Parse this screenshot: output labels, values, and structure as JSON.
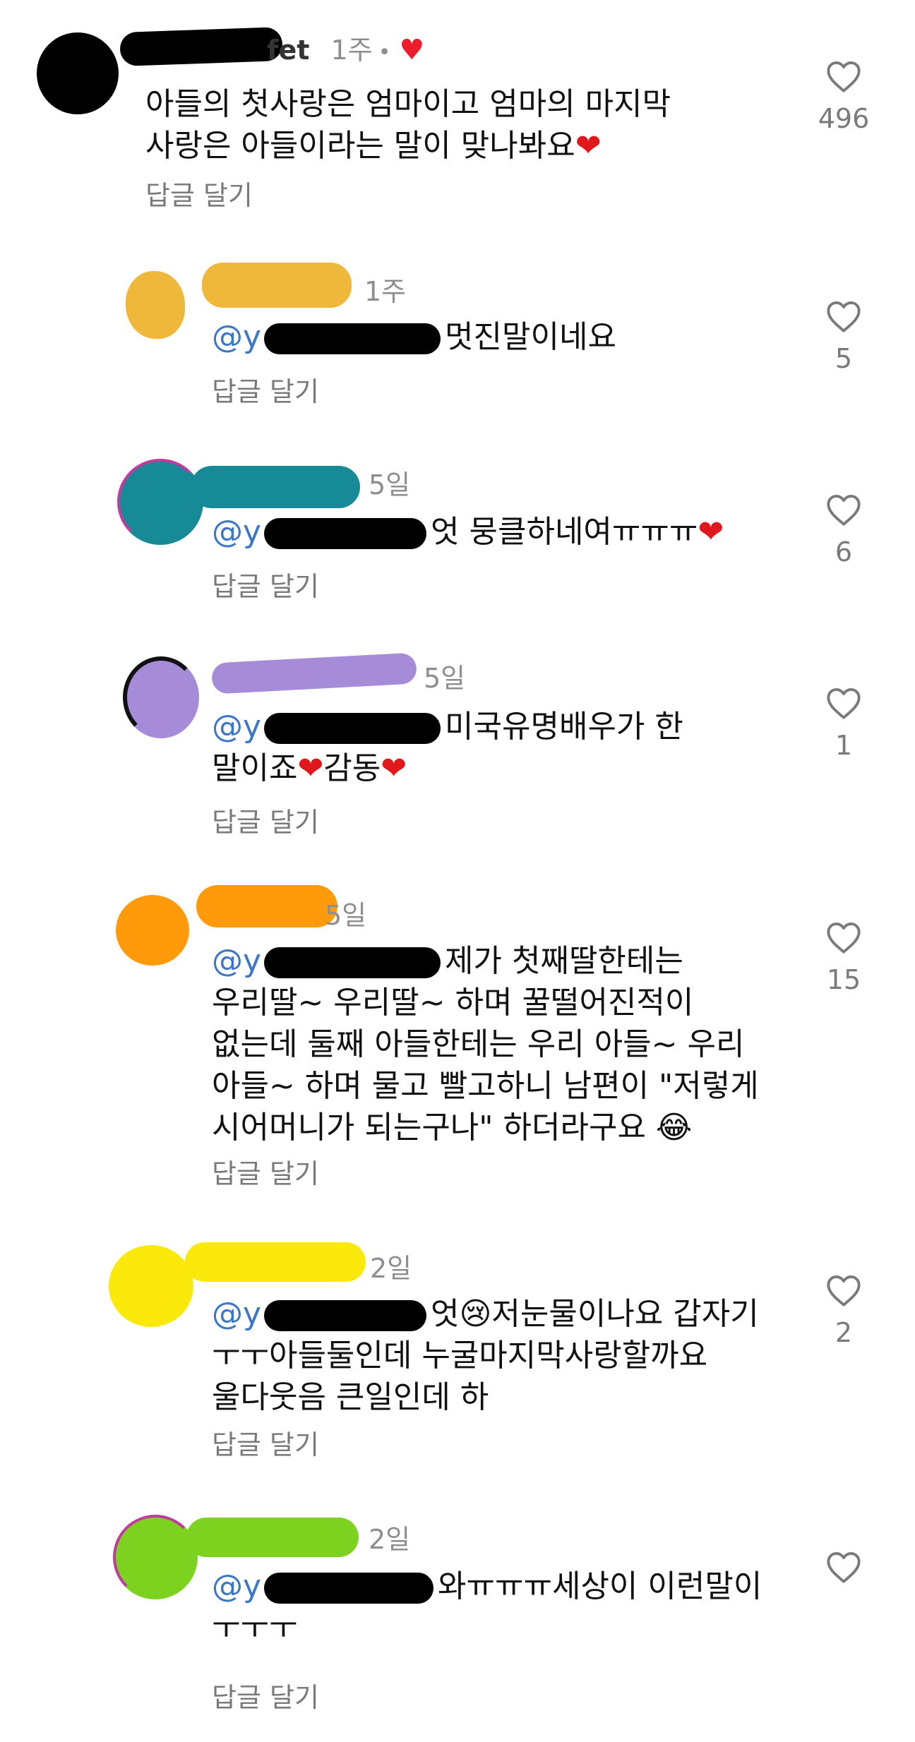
{
  "colors": {
    "mention": "#3b76c9",
    "meta": "#8e8e8e",
    "heart": "#e0181b"
  },
  "comments": [
    {
      "username_visible": "fet",
      "time": "1주",
      "author_liked": true,
      "text_lines": [
        "아들의 첫사랑은 엄마이고 엄마의 마지막",
        "사랑은 아들이라는 말이 맞나봐요"
      ],
      "reply_label": "답글 달기",
      "likes": "496",
      "avatar_color": "#000000"
    },
    {
      "time": "1주",
      "mention_prefix": "@y",
      "text_lines": [
        "멋진말이네요"
      ],
      "reply_label": "답글 달기",
      "likes": "5",
      "avatar_color": "#f0b83a"
    },
    {
      "time": "5일",
      "mention_prefix": "@y",
      "text_lines": [
        "엇 뭉클하네여ㅠㅠㅠ"
      ],
      "reply_label": "답글 달기",
      "likes": "6",
      "avatar_color": "#168a96"
    },
    {
      "time": "5일",
      "mention_prefix": "@y",
      "text_lines": [
        "미국유명배우가 한",
        "말이죠",
        "감동"
      ],
      "reply_label": "답글 달기",
      "likes": "1",
      "avatar_color": "#a68bd8"
    },
    {
      "time": "5일",
      "mention_prefix": "@y",
      "text_lines": [
        "제가 첫째딸한테는",
        "우리딸~ 우리딸~ 하며 꿀떨어진적이",
        "없는데 둘째 아들한테는 우리 아들~ 우리",
        "아들~ 하며 물고 빨고하니 남편이 \"저렇게",
        "시어머니가 되는구나\" 하더라구요 😂"
      ],
      "reply_label": "답글 달기",
      "likes": "15",
      "avatar_color": "#ff9a0a"
    },
    {
      "time": "2일",
      "mention_prefix": "@y",
      "text_lines": [
        "엇😢저눈물이나요 갑자기",
        "ㅜㅜ아들둘인데 누굴마지막사랑할까요",
        "울다웃음 큰일인데 하"
      ],
      "reply_label": "답글 달기",
      "likes": "2",
      "avatar_color": "#fbe90c"
    },
    {
      "time": "2일",
      "mention_prefix": "@y",
      "text_lines": [
        "와ㅠㅠㅠ세상이 이런말이",
        "ㅜㅜㅜ"
      ],
      "reply_label": "답글 달기",
      "likes": "",
      "avatar_color": "#7dd21f"
    }
  ]
}
